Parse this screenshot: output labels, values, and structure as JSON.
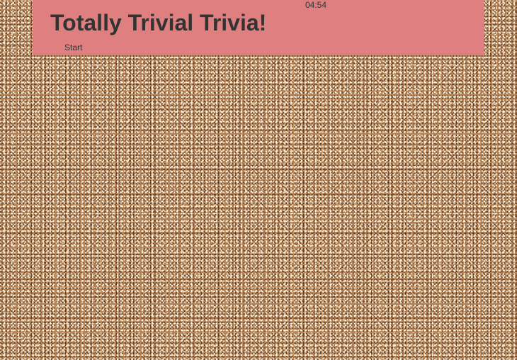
{
  "header": {
    "title": "Totally Trivial Trivia!",
    "timer": "04:54",
    "start_label": "Start"
  },
  "colors": {
    "header_background": "#e07f80",
    "text": "#333333",
    "page_texture": "#b98556"
  }
}
